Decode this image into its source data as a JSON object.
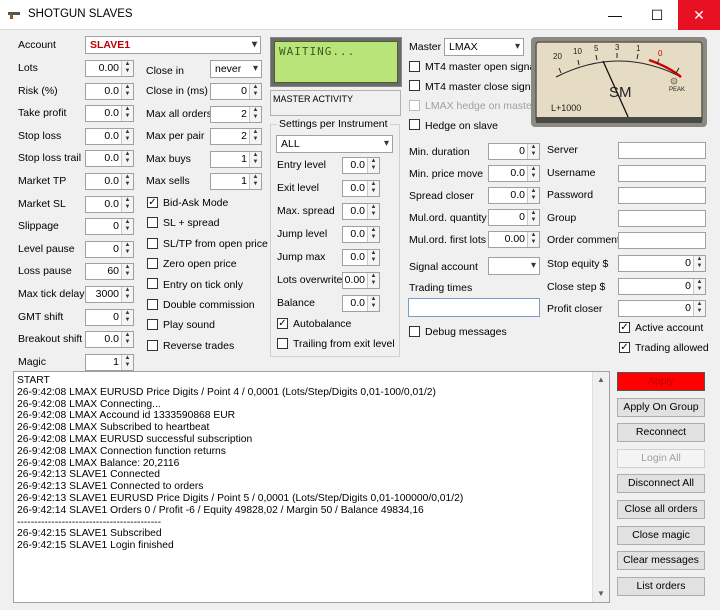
{
  "window": {
    "title": "SHOTGUN SLAVES",
    "minimize": "—",
    "maximize": "☐",
    "close": "✕"
  },
  "account": {
    "label": "Account",
    "value": "SLAVE1"
  },
  "left_fields": [
    {
      "label": "Lots",
      "value": "0.00"
    },
    {
      "label": "Risk (%)",
      "value": "0.0"
    },
    {
      "label": "Take profit",
      "value": "0.0"
    },
    {
      "label": "Stop loss",
      "value": "0.0"
    },
    {
      "label": "Stop loss trail",
      "value": "0.0"
    },
    {
      "label": "Market TP",
      "value": "0.0"
    },
    {
      "label": "Market SL",
      "value": "0.0"
    },
    {
      "label": "Slippage",
      "value": "0"
    },
    {
      "label": "Level pause",
      "value": "0"
    },
    {
      "label": "Loss pause",
      "value": "60"
    },
    {
      "label": "Max tick delay",
      "value": "3000"
    },
    {
      "label": "GMT shift",
      "value": "0"
    },
    {
      "label": "Breakout shift",
      "value": "0.0"
    },
    {
      "label": "Magic",
      "value": "1"
    }
  ],
  "close_in": {
    "label": "Close in",
    "value": "never"
  },
  "mid_fields": [
    {
      "label": "Close in (ms)",
      "value": "0"
    },
    {
      "label": "Max all orders",
      "value": "2"
    },
    {
      "label": "Max per pair",
      "value": "2"
    },
    {
      "label": "Max buys",
      "value": "1"
    },
    {
      "label": "Max sells",
      "value": "1"
    }
  ],
  "mid_checks": [
    {
      "label": "Bid-Ask Mode",
      "checked": true
    },
    {
      "label": "SL + spread",
      "checked": false
    },
    {
      "label": "SL/TP from open price",
      "checked": false
    },
    {
      "label": "Zero open price",
      "checked": false
    },
    {
      "label": "Entry on tick only",
      "checked": false
    },
    {
      "label": "Double commission",
      "checked": false
    },
    {
      "label": "Play sound",
      "checked": false
    },
    {
      "label": "Reverse trades",
      "checked": false
    }
  ],
  "lcd": {
    "text": "WAITING..."
  },
  "master_activity": {
    "label": "MASTER ACTIVITY"
  },
  "settings_group": {
    "title": "Settings per Instrument",
    "instrument": "ALL",
    "fields": [
      {
        "label": "Entry level",
        "value": "0.0"
      },
      {
        "label": "Exit level",
        "value": "0.0"
      },
      {
        "label": "Max. spread",
        "value": "0.0"
      },
      {
        "label": "Jump level",
        "value": "0.0"
      },
      {
        "label": "Jump max",
        "value": "0.0"
      },
      {
        "label": "Lots overwrite",
        "value": "0.00"
      },
      {
        "label": "Balance",
        "value": "0.0"
      }
    ],
    "checks": [
      {
        "label": "Autobalance",
        "checked": true
      },
      {
        "label": "Trailing from exit level",
        "checked": false
      }
    ]
  },
  "master": {
    "label": "Master",
    "value": "LMAX",
    "checks": [
      {
        "label": "MT4 master open signal",
        "checked": false,
        "disabled": false
      },
      {
        "label": "MT4 master close signal",
        "checked": false,
        "disabled": false
      },
      {
        "label": "LMAX hedge on master",
        "checked": false,
        "disabled": true
      },
      {
        "label": "Hedge on slave",
        "checked": false,
        "disabled": false
      }
    ]
  },
  "meter": {
    "brand": "SM",
    "scale": [
      "20",
      "10",
      "5",
      "3",
      "1",
      "0"
    ],
    "range": "L+1000",
    "peak": "PEAK"
  },
  "right_fields": [
    {
      "label": "Min. duration",
      "value": "0"
    },
    {
      "label": "Min. price move",
      "value": "0.0"
    },
    {
      "label": "Spread closer",
      "value": "0.0"
    },
    {
      "label": "Mul.ord. quantity",
      "value": "0"
    },
    {
      "label": "Mul.ord. first lots",
      "value": "0.00"
    }
  ],
  "signal_account": {
    "label": "Signal account",
    "value": ""
  },
  "trading_times": {
    "label": "Trading times",
    "value": ""
  },
  "debug_messages": {
    "label": "Debug messages",
    "checked": false
  },
  "server_fields": [
    {
      "label": "Server",
      "value": ""
    },
    {
      "label": "Username",
      "value": ""
    },
    {
      "label": "Password",
      "value": ""
    },
    {
      "label": "Group",
      "value": ""
    },
    {
      "label": "Order comment",
      "value": ""
    }
  ],
  "equity_fields": [
    {
      "label": "Stop equity $",
      "value": "0"
    },
    {
      "label": "Close step $",
      "value": "0"
    },
    {
      "label": "Profit closer",
      "value": "0"
    }
  ],
  "account_checks": [
    {
      "label": "Active account",
      "checked": true
    },
    {
      "label": "Trading allowed",
      "checked": true
    }
  ],
  "log": [
    "START",
    "26-9:42:08 LMAX EURUSD Price Digits / Point 4 / 0,0001 (Lots/Step/Digits 0,01-100/0,01/2)",
    "26-9:42:08 LMAX Connecting...",
    "26-9:42:08 LMAX Accound id 1333590868 EUR",
    "26-9:42:08 LMAX Subscribed to heartbeat",
    "26-9:42:08 LMAX EURUSD successful subscription",
    "26-9:42:08 LMAX Connection function returns",
    "26-9:42:08 LMAX Balance: 20,2116",
    "26-9:42:13 SLAVE1 Connected",
    "26-9:42:13 SLAVE1 Connected to orders",
    "26-9:42:13 SLAVE1 EURUSD Price Digits / Point 5 / 0,0001 (Lots/Step/Digits 0,01-100000/0,01/2)",
    "26-9:42:14 SLAVE1 Orders 0 / Profit -6 / Equity 49828,02 / Margin 50 / Balance 49834,16",
    "------------------------------------------",
    "26-9:42:15 SLAVE1 Subscribed",
    "26-9:42:15 SLAVE1 Login finished"
  ],
  "buttons": [
    {
      "label": "Apply",
      "state": "highlight"
    },
    {
      "label": "Apply On Group",
      "state": "normal"
    },
    {
      "label": "Reconnect",
      "state": "normal"
    },
    {
      "label": "Login All",
      "state": "disabled"
    },
    {
      "label": "Disconnect All",
      "state": "normal"
    },
    {
      "label": "Close all orders",
      "state": "normal"
    },
    {
      "label": "Close magic",
      "state": "normal"
    },
    {
      "label": "Clear messages",
      "state": "normal"
    },
    {
      "label": "List orders",
      "state": "normal"
    }
  ],
  "colors": {
    "apply_bg": "#ff0000",
    "account_text": "#c00000",
    "lcd_bg": "#b8e47a"
  }
}
